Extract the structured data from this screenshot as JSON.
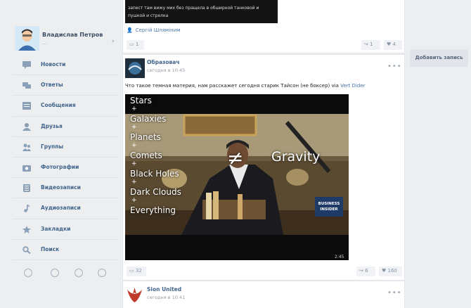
{
  "profile": {
    "name": "Владислав Петров",
    "status": "...",
    "caret": "›"
  },
  "nav": {
    "items": [
      {
        "label": "Новости",
        "icon": "news-icon"
      },
      {
        "label": "Ответы",
        "icon": "replies-icon"
      },
      {
        "label": "Сообщения",
        "icon": "messages-icon"
      },
      {
        "label": "Друзья",
        "icon": "friends-icon"
      },
      {
        "label": "Группы",
        "icon": "groups-icon"
      },
      {
        "label": "Фотографии",
        "icon": "photos-icon"
      },
      {
        "label": "Видеозаписи",
        "icon": "videos-icon"
      },
      {
        "label": "Аудиозаписи",
        "icon": "audio-icon"
      },
      {
        "label": "Закладки",
        "icon": "bookmarks-icon"
      },
      {
        "label": "Поиск",
        "icon": "search-icon"
      }
    ],
    "bottom_icons": [
      "settings-icon",
      "help-icon",
      "language-icon",
      "power-icon"
    ]
  },
  "top_post": {
    "video_text_line1": "запест там вижу мих без пращела в обширной танковой и",
    "video_text_line2": "пушкой и стрелка",
    "author": "Сергій Шляміним",
    "comments": "1",
    "shares": "1",
    "likes": "4"
  },
  "main_post": {
    "group_name": "Образовач",
    "time": "сегодня в 10:45",
    "text": "Что такое темная материя, нам расскажет сегодня старик Тайсон (не боксер) via ",
    "text_link": "Vert Dider",
    "video": {
      "overlay_list": [
        "Stars",
        "Galaxies",
        "Planets",
        "Comets",
        "Black Holes",
        "Dark Clouds",
        "Everything"
      ],
      "plus": "+",
      "neq": "≠",
      "gravity": "Gravity",
      "brand": "BUSINESS INSIDER",
      "duration": "2:45"
    },
    "comments": "32",
    "shares": "6",
    "likes": "160"
  },
  "next_post": {
    "group_name": "Sion United",
    "time": "сегодня в 10:41"
  },
  "right": {
    "add_post": "Добавить запись"
  },
  "colors": {
    "bg": "#edeef0",
    "link": "#4a76a8",
    "nav_text": "#41658d"
  }
}
